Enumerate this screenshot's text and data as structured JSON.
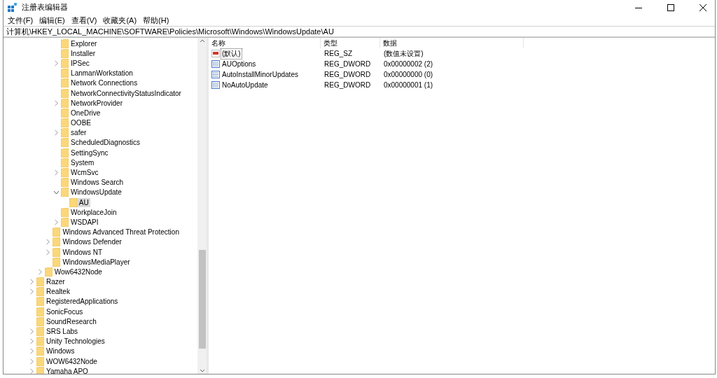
{
  "window": {
    "title": "注册表编辑器"
  },
  "menu": [
    "文件(F)",
    "编辑(E)",
    "查看(V)",
    "收藏夹(A)",
    "帮助(H)"
  ],
  "address": "计算机\\HKEY_LOCAL_MACHINE\\SOFTWARE\\Policies\\Microsoft\\Windows\\WindowsUpdate\\AU",
  "tree": {
    "continued": {
      "children": [
        {
          "children": [
            {
              "children": [
                {
                  "label": "Explorer",
                  "has_children": false,
                  "expanded": false,
                  "selected": false
                },
                {
                  "label": "Installer",
                  "has_children": false,
                  "expanded": false,
                  "selected": false
                },
                {
                  "label": "IPSec",
                  "has_children": true,
                  "expanded": false,
                  "selected": false
                },
                {
                  "label": "LanmanWorkstation",
                  "has_children": false,
                  "expanded": false,
                  "selected": false
                },
                {
                  "label": "Network Connections",
                  "has_children": false,
                  "expanded": false,
                  "selected": false
                },
                {
                  "label": "NetworkConnectivityStatusIndicator",
                  "has_children": false,
                  "expanded": false,
                  "selected": false
                },
                {
                  "label": "NetworkProvider",
                  "has_children": true,
                  "expanded": false,
                  "selected": false
                },
                {
                  "label": "OneDrive",
                  "has_children": false,
                  "expanded": false,
                  "selected": false
                },
                {
                  "label": "OOBE",
                  "has_children": false,
                  "expanded": false,
                  "selected": false
                },
                {
                  "label": "safer",
                  "has_children": true,
                  "expanded": false,
                  "selected": false
                },
                {
                  "label": "ScheduledDiagnostics",
                  "has_children": false,
                  "expanded": false,
                  "selected": false
                },
                {
                  "label": "SettingSync",
                  "has_children": false,
                  "expanded": false,
                  "selected": false
                },
                {
                  "label": "System",
                  "has_children": false,
                  "expanded": false,
                  "selected": false
                },
                {
                  "label": "WcmSvc",
                  "has_children": true,
                  "expanded": false,
                  "selected": false
                },
                {
                  "label": "Windows Search",
                  "has_children": false,
                  "expanded": false,
                  "selected": false
                },
                {
                  "label": "WindowsUpdate",
                  "has_children": true,
                  "expanded": true,
                  "selected": false,
                  "children": [
                    {
                      "label": "AU",
                      "has_children": false,
                      "expanded": false,
                      "selected": true
                    }
                  ]
                },
                {
                  "label": "WorkplaceJoin",
                  "has_children": false,
                  "expanded": false,
                  "selected": false
                },
                {
                  "label": "WSDAPI",
                  "has_children": true,
                  "expanded": false,
                  "selected": false
                }
              ]
            },
            {
              "label": "Windows Advanced Threat Protection",
              "has_children": false,
              "expanded": false,
              "selected": false
            },
            {
              "label": "Windows Defender",
              "has_children": true,
              "expanded": false,
              "selected": false
            },
            {
              "label": "Windows NT",
              "has_children": true,
              "expanded": false,
              "selected": false
            },
            {
              "label": "WindowsMediaPlayer",
              "has_children": false,
              "expanded": false,
              "selected": false
            }
          ]
        },
        {
          "label": "Wow6432Node",
          "has_children": true,
          "expanded": false,
          "selected": false
        }
      ]
    },
    "items": [
      {
        "label": "Razer",
        "has_children": true,
        "expanded": false,
        "selected": false
      },
      {
        "label": "Realtek",
        "has_children": true,
        "expanded": false,
        "selected": false
      },
      {
        "label": "RegisteredApplications",
        "has_children": false,
        "expanded": false,
        "selected": false
      },
      {
        "label": "SonicFocus",
        "has_children": false,
        "expanded": false,
        "selected": false
      },
      {
        "label": "SoundResearch",
        "has_children": false,
        "expanded": false,
        "selected": false
      },
      {
        "label": "SRS Labs",
        "has_children": true,
        "expanded": false,
        "selected": false
      },
      {
        "label": "Unity Technologies",
        "has_children": true,
        "expanded": false,
        "selected": false
      },
      {
        "label": "Windows",
        "has_children": true,
        "expanded": false,
        "selected": false
      },
      {
        "label": "WOW6432Node",
        "has_children": true,
        "expanded": false,
        "selected": false
      },
      {
        "label": "Yamaha APO",
        "has_children": true,
        "expanded": false,
        "selected": false
      }
    ]
  },
  "values": {
    "columns": [
      "名称",
      "类型",
      "数据"
    ],
    "rows": [
      {
        "kind": "string",
        "name": "(默认)",
        "type": "REG_SZ",
        "data": "(数值未设置)",
        "selected": true
      },
      {
        "kind": "dword",
        "name": "AUOptions",
        "type": "REG_DWORD",
        "data": "0x00000002 (2)",
        "selected": false
      },
      {
        "kind": "dword",
        "name": "AutoInstallMinorUpdates",
        "type": "REG_DWORD",
        "data": "0x00000000 (0)",
        "selected": false
      },
      {
        "kind": "dword",
        "name": "NoAutoUpdate",
        "type": "REG_DWORD",
        "data": "0x00000001 (1)",
        "selected": false
      }
    ]
  }
}
